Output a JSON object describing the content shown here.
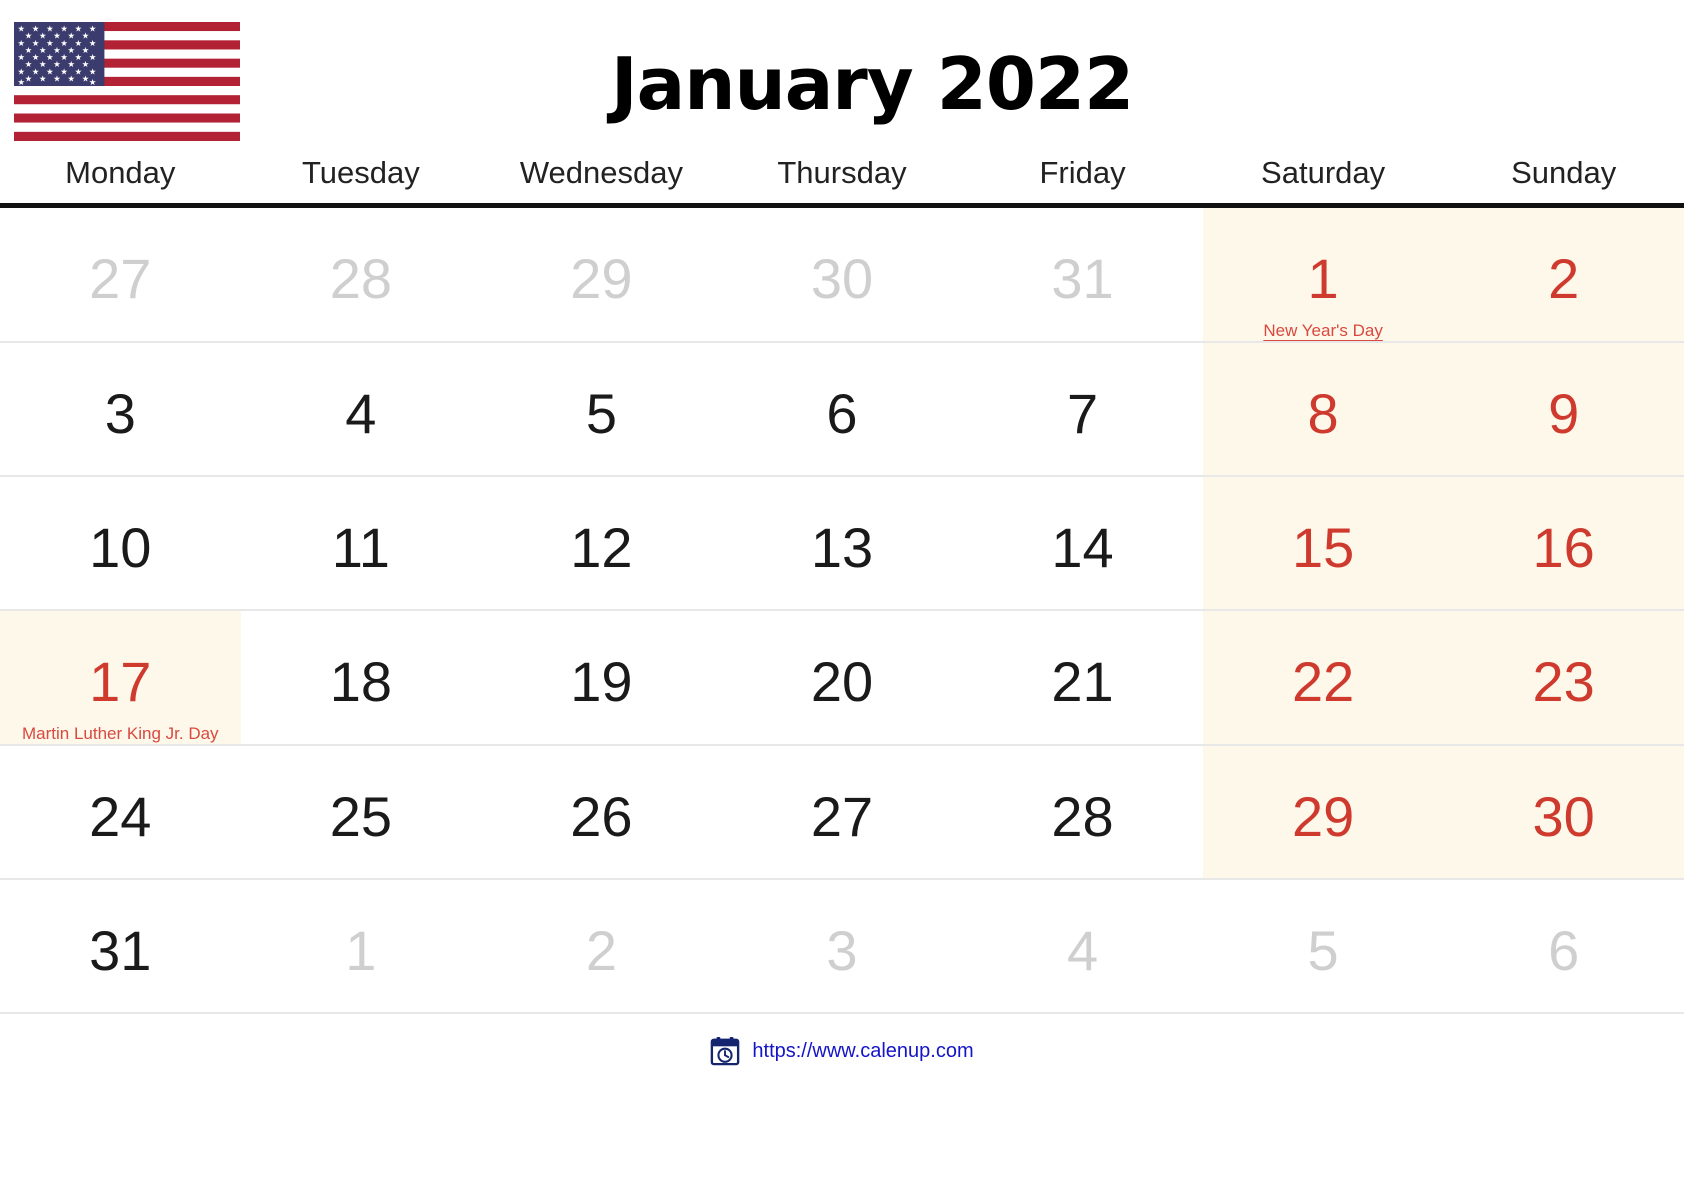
{
  "header": {
    "flag_icon": "us-flag-icon",
    "title": "January 2022"
  },
  "colors": {
    "weekend_bg": "#fdf8ea",
    "holiday_red": "#d9493f",
    "date_red": "#cf3a2e",
    "out_of_month_gray": "#cfcfcf",
    "link_blue": "#1414c8",
    "header_rule": "#111111"
  },
  "weekdays": [
    "Monday",
    "Tuesday",
    "Wednesday",
    "Thursday",
    "Friday",
    "Saturday",
    "Sunday"
  ],
  "weeks": [
    [
      {
        "num": "27",
        "style": "out",
        "weekend": false,
        "holiday": ""
      },
      {
        "num": "28",
        "style": "out",
        "weekend": false,
        "holiday": ""
      },
      {
        "num": "29",
        "style": "out",
        "weekend": false,
        "holiday": ""
      },
      {
        "num": "30",
        "style": "out",
        "weekend": false,
        "holiday": ""
      },
      {
        "num": "31",
        "style": "out",
        "weekend": false,
        "holiday": ""
      },
      {
        "num": "1",
        "style": "red",
        "weekend": true,
        "holiday": "New Year's Day"
      },
      {
        "num": "2",
        "style": "red",
        "weekend": true,
        "holiday": ""
      }
    ],
    [
      {
        "num": "3",
        "style": "",
        "weekend": false,
        "holiday": ""
      },
      {
        "num": "4",
        "style": "",
        "weekend": false,
        "holiday": ""
      },
      {
        "num": "5",
        "style": "",
        "weekend": false,
        "holiday": ""
      },
      {
        "num": "6",
        "style": "",
        "weekend": false,
        "holiday": ""
      },
      {
        "num": "7",
        "style": "",
        "weekend": false,
        "holiday": ""
      },
      {
        "num": "8",
        "style": "red",
        "weekend": true,
        "holiday": ""
      },
      {
        "num": "9",
        "style": "red",
        "weekend": true,
        "holiday": ""
      }
    ],
    [
      {
        "num": "10",
        "style": "",
        "weekend": false,
        "holiday": ""
      },
      {
        "num": "11",
        "style": "",
        "weekend": false,
        "holiday": ""
      },
      {
        "num": "12",
        "style": "",
        "weekend": false,
        "holiday": ""
      },
      {
        "num": "13",
        "style": "",
        "weekend": false,
        "holiday": ""
      },
      {
        "num": "14",
        "style": "",
        "weekend": false,
        "holiday": ""
      },
      {
        "num": "15",
        "style": "red",
        "weekend": true,
        "holiday": ""
      },
      {
        "num": "16",
        "style": "red",
        "weekend": true,
        "holiday": ""
      }
    ],
    [
      {
        "num": "17",
        "style": "red",
        "weekend": true,
        "holiday": "Martin Luther King Jr. Day"
      },
      {
        "num": "18",
        "style": "",
        "weekend": false,
        "holiday": ""
      },
      {
        "num": "19",
        "style": "",
        "weekend": false,
        "holiday": ""
      },
      {
        "num": "20",
        "style": "",
        "weekend": false,
        "holiday": ""
      },
      {
        "num": "21",
        "style": "",
        "weekend": false,
        "holiday": ""
      },
      {
        "num": "22",
        "style": "red",
        "weekend": true,
        "holiday": ""
      },
      {
        "num": "23",
        "style": "red",
        "weekend": true,
        "holiday": ""
      }
    ],
    [
      {
        "num": "24",
        "style": "",
        "weekend": false,
        "holiday": ""
      },
      {
        "num": "25",
        "style": "",
        "weekend": false,
        "holiday": ""
      },
      {
        "num": "26",
        "style": "",
        "weekend": false,
        "holiday": ""
      },
      {
        "num": "27",
        "style": "",
        "weekend": false,
        "holiday": ""
      },
      {
        "num": "28",
        "style": "",
        "weekend": false,
        "holiday": ""
      },
      {
        "num": "29",
        "style": "red",
        "weekend": true,
        "holiday": ""
      },
      {
        "num": "30",
        "style": "red",
        "weekend": true,
        "holiday": ""
      }
    ],
    [
      {
        "num": "31",
        "style": "",
        "weekend": false,
        "holiday": ""
      },
      {
        "num": "1",
        "style": "out",
        "weekend": false,
        "holiday": ""
      },
      {
        "num": "2",
        "style": "out",
        "weekend": false,
        "holiday": ""
      },
      {
        "num": "3",
        "style": "out",
        "weekend": false,
        "holiday": ""
      },
      {
        "num": "4",
        "style": "out",
        "weekend": false,
        "holiday": ""
      },
      {
        "num": "5",
        "style": "out",
        "weekend": false,
        "holiday": ""
      },
      {
        "num": "6",
        "style": "out",
        "weekend": false,
        "holiday": ""
      }
    ]
  ],
  "footer": {
    "icon": "calendar-clock-icon",
    "link_text": "https://www.calenup.com"
  }
}
